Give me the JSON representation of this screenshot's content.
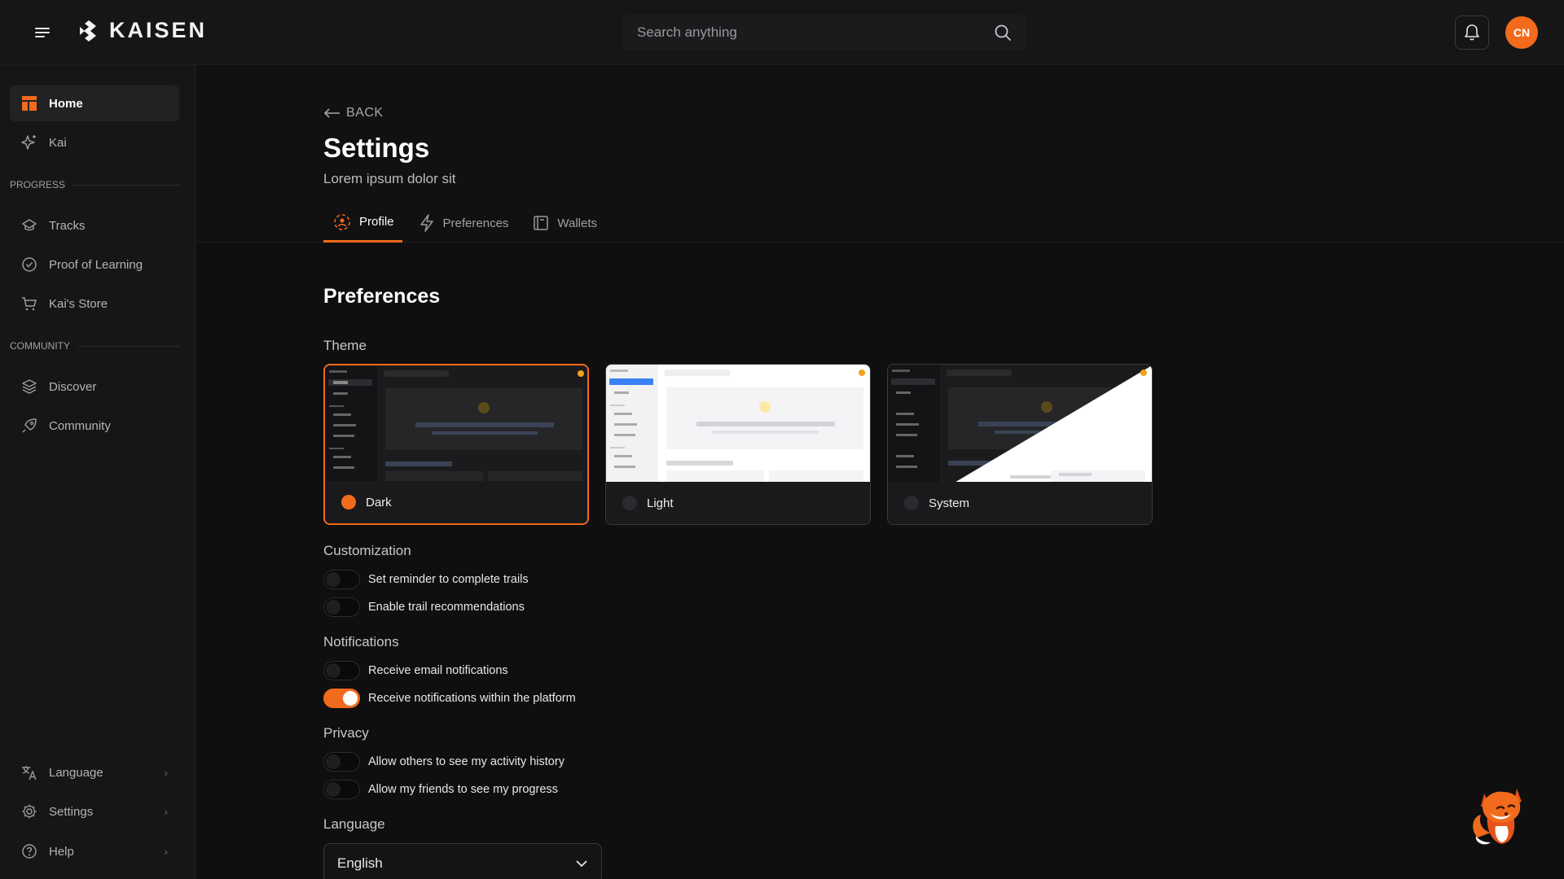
{
  "app": {
    "name": "KAISEN"
  },
  "search": {
    "placeholder": "Search anything"
  },
  "user": {
    "initials": "CN"
  },
  "colors": {
    "accent": "#f26a1b",
    "background": "#0f0f10",
    "panel": "#161617"
  },
  "sidebar": {
    "top_items": [
      {
        "label": "Home",
        "icon": "home-icon",
        "active": true
      },
      {
        "label": "Kai",
        "icon": "sparkle-icon"
      }
    ],
    "sections": [
      {
        "label": "PROGRESS",
        "items": [
          {
            "label": "Tracks",
            "icon": "layers-icon"
          },
          {
            "label": "Proof of Learning",
            "icon": "check-circle-icon"
          },
          {
            "label": "Kai's Store",
            "icon": "cart-icon"
          }
        ]
      },
      {
        "label": "COMMUNITY",
        "items": [
          {
            "label": "Discover",
            "icon": "stack-icon"
          },
          {
            "label": "Community",
            "icon": "rocket-icon"
          }
        ]
      }
    ],
    "bottom_items": [
      {
        "label": "Language",
        "icon": "translate-icon"
      },
      {
        "label": "Settings",
        "icon": "gear-icon"
      },
      {
        "label": "Help",
        "icon": "help-icon"
      }
    ]
  },
  "page": {
    "back_label": "BACK",
    "title": "Settings",
    "subtitle": "Lorem ipsum dolor sit",
    "tabs": [
      {
        "label": "Profile",
        "active": true
      },
      {
        "label": "Preferences"
      },
      {
        "label": "Wallets"
      }
    ]
  },
  "preferences": {
    "title": "Preferences",
    "theme": {
      "label": "Theme",
      "options": [
        {
          "label": "Dark",
          "selected": true
        },
        {
          "label": "Light",
          "selected": false
        },
        {
          "label": "System",
          "selected": false
        }
      ]
    },
    "customization": {
      "label": "Customization",
      "toggles": [
        {
          "label": "Set reminder to complete trails",
          "on": false
        },
        {
          "label": "Enable trail recommendations",
          "on": false
        }
      ]
    },
    "notifications": {
      "label": "Notifications",
      "toggles": [
        {
          "label": "Receive email notifications",
          "on": false
        },
        {
          "label": "Receive notifications within the platform",
          "on": true
        }
      ]
    },
    "privacy": {
      "label": "Privacy",
      "toggles": [
        {
          "label": "Allow others to see my activity history",
          "on": false
        },
        {
          "label": "Allow my friends to see my progress",
          "on": false
        }
      ]
    },
    "language": {
      "label": "Language",
      "value": "English"
    }
  }
}
